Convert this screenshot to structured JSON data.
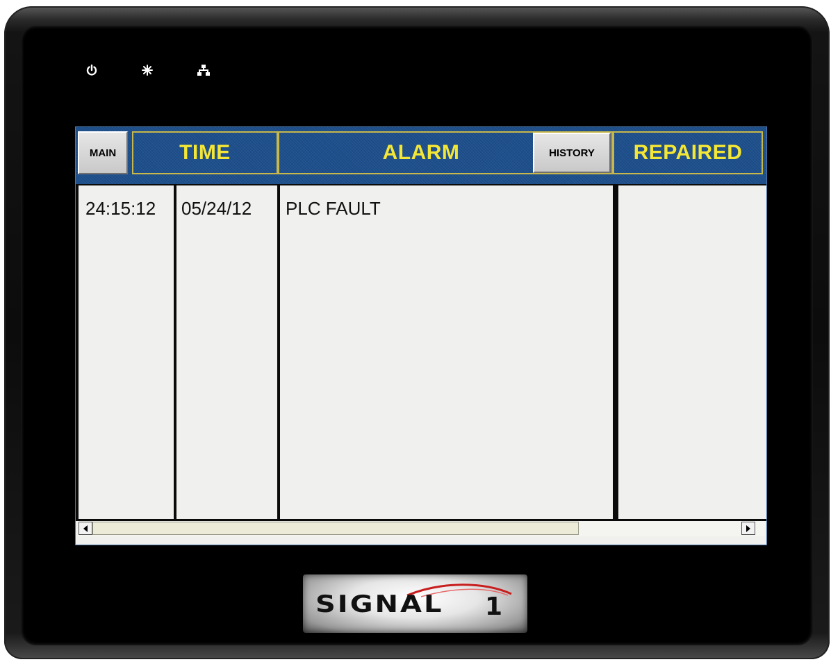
{
  "header": {
    "main_button": "MAIN",
    "time_label": "TIME",
    "alarm_label": "ALARM",
    "history_button": "HISTORY",
    "repaired_label": "REPAIRED"
  },
  "rows": [
    {
      "time": "24:15:12",
      "date": "05/24/12",
      "alarm": "PLC FAULT",
      "repaired": ""
    }
  ],
  "logo": {
    "brand": "SIGNAL",
    "number": "1"
  },
  "indicators": [
    "power-icon",
    "sun-icon",
    "network-icon"
  ],
  "colors": {
    "header_bg": "#1d4f8c",
    "header_text": "#f4e635",
    "header_border": "#c8b84a",
    "table_bg": "#f0f0ee"
  }
}
